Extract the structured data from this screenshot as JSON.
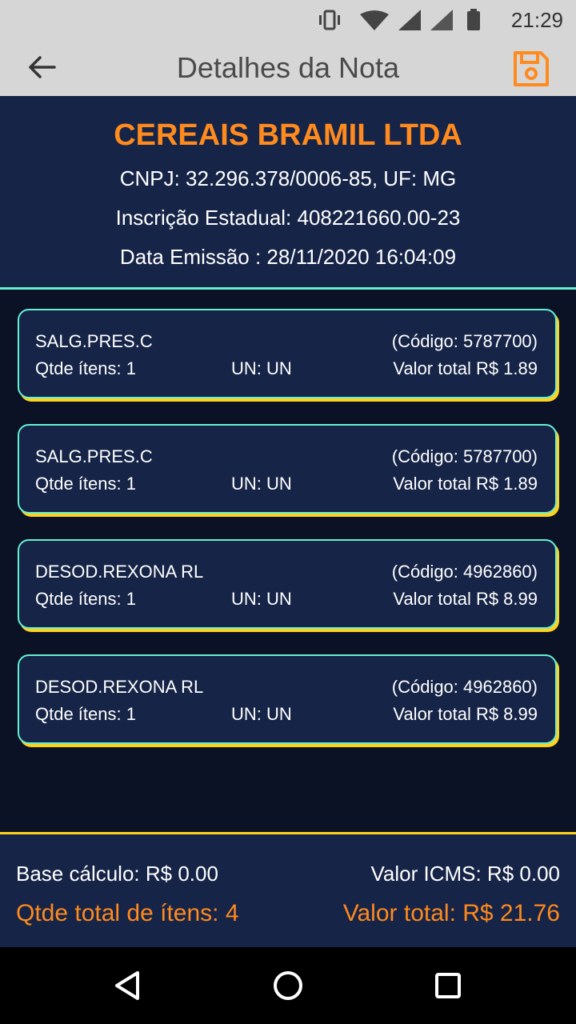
{
  "status_bar": {
    "time": "21:29",
    "icons": [
      "vibrate-icon",
      "wifi-icon",
      "signal-icon",
      "signal-icon",
      "battery-icon"
    ]
  },
  "app_bar": {
    "title": "Detalhes da Nota",
    "back_icon": "arrow-left-icon",
    "save_icon": "floppy-disk-icon"
  },
  "header": {
    "company": "CEREAIS BRAMIL LTDA",
    "cnpj_line": "CNPJ: 32.296.378/0006-85, UF: MG",
    "ie_line": "Inscrição Estadual: 408221660.00-23",
    "date_line": "Data Emissão : 28/11/2020 16:04:09"
  },
  "items": [
    {
      "name": "SALG.PRES.C",
      "code": "(Código: 5787700)",
      "qty": "Qtde ítens: 1",
      "unit": "UN: UN",
      "total": "Valor total R$ 1.89"
    },
    {
      "name": "SALG.PRES.C",
      "code": "(Código: 5787700)",
      "qty": "Qtde ítens: 1",
      "unit": "UN: UN",
      "total": "Valor total R$ 1.89"
    },
    {
      "name": "DESOD.REXONA RL",
      "code": "(Código: 4962860)",
      "qty": "Qtde ítens: 1",
      "unit": "UN: UN",
      "total": "Valor total R$ 8.99"
    },
    {
      "name": "DESOD.REXONA RL",
      "code": "(Código: 4962860)",
      "qty": "Qtde ítens: 1",
      "unit": "UN: UN",
      "total": "Valor total R$ 8.99"
    }
  ],
  "footer": {
    "base": "Base cálculo: R$ 0.00",
    "icms": "Valor ICMS: R$ 0.00",
    "qty_total": "Qtde total de ítens: 4",
    "value_total": "Valor total: R$ 21.76"
  },
  "nav_bar": {
    "icons": [
      "back-triangle-icon",
      "home-circle-icon",
      "recents-square-icon"
    ]
  },
  "colors": {
    "accent": "#ff8a1e",
    "card_border": "#64f0d2",
    "card_shadow": "#ffd21e",
    "panel": "#162447",
    "background": "#0c1226"
  }
}
